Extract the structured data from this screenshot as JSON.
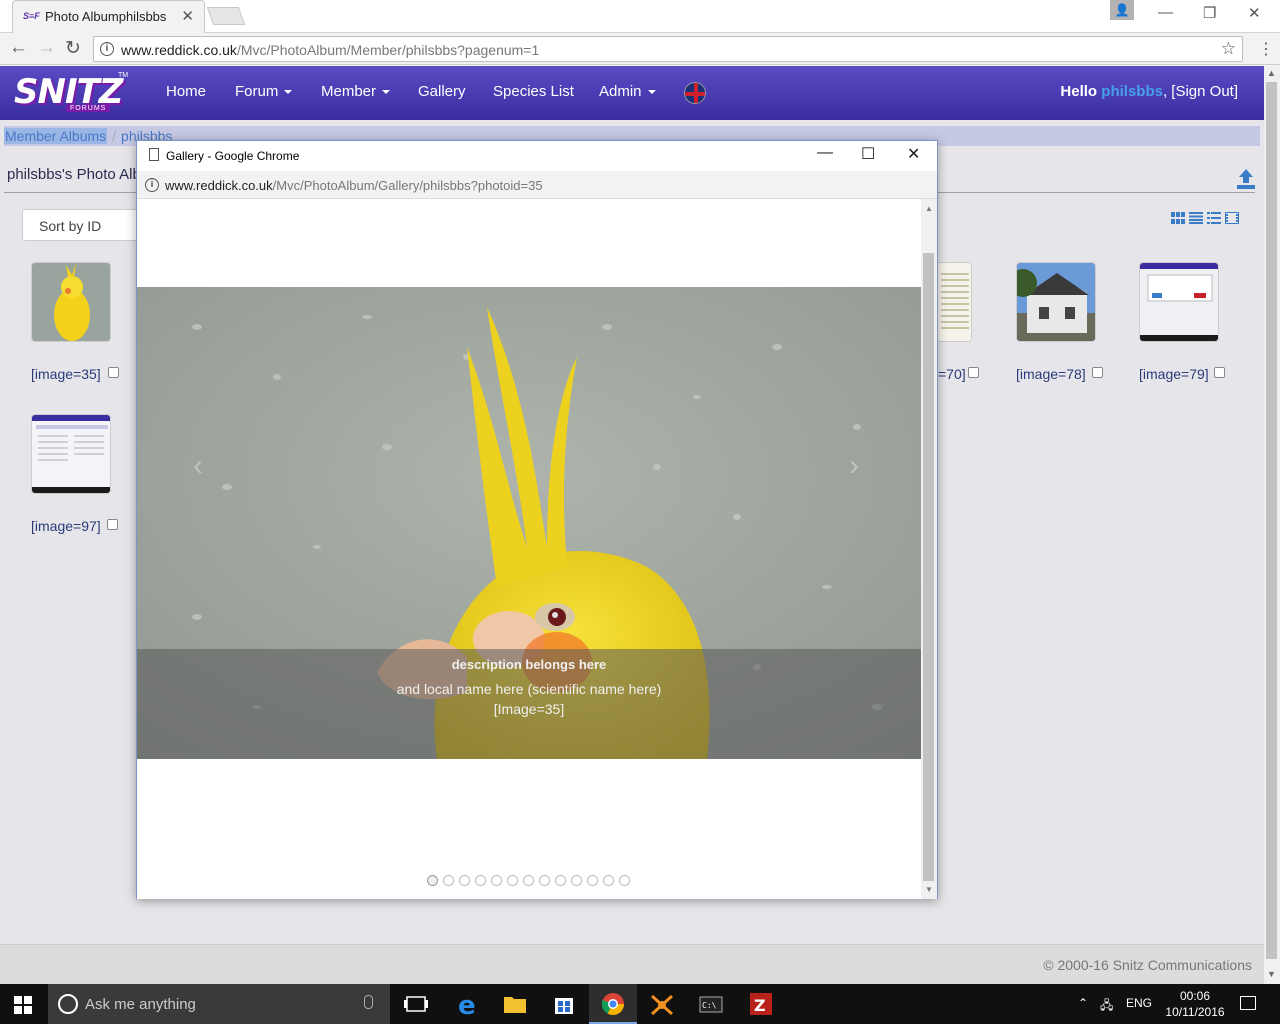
{
  "browser": {
    "tab_title": "Photo Albumphilsbbs",
    "favicon_text": "S≡F",
    "url_host": "www.reddick.co.uk",
    "url_path": "/Mvc/PhotoAlbum/Member/philsbbs?pagenum=1"
  },
  "navbar": {
    "logo_text": "SNITZ",
    "logo_sub": "FORUMS",
    "logo_tm": "TM",
    "items": [
      {
        "label": "Home",
        "dropdown": false
      },
      {
        "label": "Forum",
        "dropdown": true
      },
      {
        "label": "Member",
        "dropdown": true
      },
      {
        "label": "Gallery",
        "dropdown": false
      },
      {
        "label": "Species List",
        "dropdown": false
      },
      {
        "label": "Admin",
        "dropdown": true
      }
    ],
    "hello": "Hello",
    "username": "philsbbs",
    "signout": ", [Sign Out]"
  },
  "breadcrumb": {
    "items": [
      "Member Albums",
      "philsbbs"
    ],
    "separator": "/"
  },
  "album": {
    "title": "philsbbs's Photo Albu",
    "sort_label": "Sort by ID"
  },
  "thumbnails": [
    {
      "label": "[image=35]"
    },
    {
      "label": "=70]"
    },
    {
      "label": "[image=78]"
    },
    {
      "label": "[image=79]"
    },
    {
      "label": "[image=97]"
    }
  ],
  "footer": {
    "copyright": "© 2000-16 Snitz Communications"
  },
  "popup": {
    "window_title": "Gallery - Google Chrome",
    "url_host": "www.reddick.co.uk",
    "url_path": "/Mvc/PhotoAlbum/Gallery/philsbbs?photoid=35",
    "caption_title": "description belongs here",
    "caption_line2": "and local name here (scientific name here)",
    "caption_line3": "[Image=35]",
    "indicator_count": 13,
    "active_indicator": 0
  },
  "taskbar": {
    "search_placeholder": "Ask me anything",
    "language": "ENG",
    "time": "00:06",
    "date": "10/11/2016"
  },
  "colors": {
    "navbar": "#4a3cb4",
    "link": "#4a77c8",
    "username": "#4aa0e8"
  }
}
